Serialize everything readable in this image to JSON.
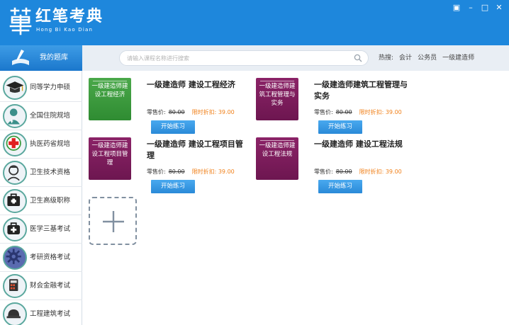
{
  "app": {
    "title": "红笔考典",
    "subtitle": "Hong Bi Kao Dian"
  },
  "window_controls": [
    "▣",
    "–",
    "□",
    "✕"
  ],
  "search": {
    "placeholder": "请输入课程名称进行搜索",
    "hot_label": "热搜:",
    "hot_items": [
      "会计",
      "公务员",
      "一级建造师"
    ]
  },
  "sidebar": {
    "header": "我的题库",
    "items": [
      {
        "label": "同等学力申硕",
        "icon": "graduation-cap-icon"
      },
      {
        "label": "全国住院规培",
        "icon": "doctor-icon"
      },
      {
        "label": "执医药省规培",
        "icon": "red-cross-icon"
      },
      {
        "label": "卫生技术资格",
        "icon": "nurse-icon"
      },
      {
        "label": "卫生高级职称",
        "icon": "medical-kit-icon"
      },
      {
        "label": "医学三基考试",
        "icon": "medical-bag-icon"
      },
      {
        "label": "考研资格考试",
        "icon": "gear-icon"
      },
      {
        "label": "财会金融考试",
        "icon": "calculator-icon"
      },
      {
        "label": "工程建筑考试",
        "icon": "hard-hat-icon"
      }
    ]
  },
  "courses": [
    {
      "cover": "一级建造师建设工程经济",
      "color": "green",
      "title": "一级建造师 建设工程经济",
      "price_label": "零售价:",
      "price": "80.00",
      "discount": "限时折扣: 39.00",
      "button": "开始练习"
    },
    {
      "cover": "一级建造师建筑工程管理与实务",
      "color": "purple",
      "title": "一级建造师建筑工程管理与实务",
      "price_label": "零售价:",
      "price": "80.00",
      "discount": "限时折扣: 39.00",
      "button": "开始练习"
    },
    {
      "cover": "一级建造师建设工程项目管理",
      "color": "purple",
      "title": "一级建造师 建设工程项目管理",
      "price_label": "零售价:",
      "price": "80.00",
      "discount": "限时折扣: 39.00",
      "button": "开始练习"
    },
    {
      "cover": "一级建造师建设工程法规",
      "color": "purple",
      "title": "一级建造师 建设工程法规",
      "price_label": "零售价:",
      "price": "80.00",
      "discount": "限时折扣: 39.00",
      "button": "开始练习"
    }
  ],
  "colors": {
    "header_blue": "#1e87dc",
    "green_cover": "#3a9a3c",
    "purple_cover": "#7d1c5c",
    "discount_orange": "#f0801a",
    "button_blue": "#2f95e0"
  }
}
